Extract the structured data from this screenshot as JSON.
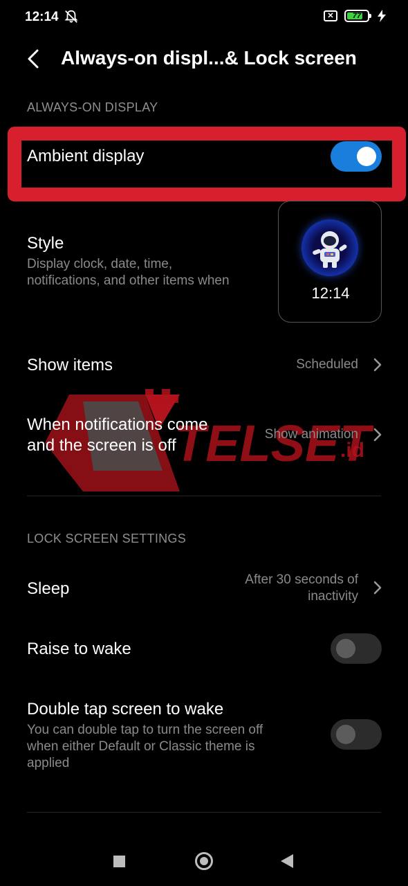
{
  "status_bar": {
    "time": "12:14",
    "battery_level": "77"
  },
  "header": {
    "title": "Always-on displ...& Lock screen"
  },
  "sections": {
    "always_on": "ALWAYS-ON DISPLAY",
    "lock_screen": "LOCK SCREEN SETTINGS"
  },
  "rows": {
    "ambient_display": {
      "title": "Ambient display",
      "enabled": true
    },
    "style": {
      "title": "Style",
      "subtitle_line1": "Display clock, date, time,",
      "subtitle_line2": "notifications, and other items when",
      "preview_time": "12:14"
    },
    "show_items": {
      "title": "Show items",
      "value": "Scheduled"
    },
    "notifications": {
      "title_line1": "When notifications come",
      "title_line2": "and the screen is off",
      "value": "Show animation"
    },
    "sleep": {
      "title": "Sleep",
      "value_line1": "After 30 seconds of",
      "value_line2": "inactivity"
    },
    "raise_to_wake": {
      "title": "Raise to wake",
      "enabled": false
    },
    "double_tap": {
      "title": "Double tap screen to wake",
      "subtitle_line1": "You can double tap to turn the screen off",
      "subtitle_line2": "when either Default or Classic theme is",
      "subtitle_line3": "applied",
      "enabled": false
    }
  },
  "watermark": {
    "brand": "TELSET",
    "suffix": ".id"
  },
  "colors": {
    "accent_blue": "#1a7fdc",
    "highlight_red": "#d71f2e",
    "battery_green": "#3fd13f"
  }
}
